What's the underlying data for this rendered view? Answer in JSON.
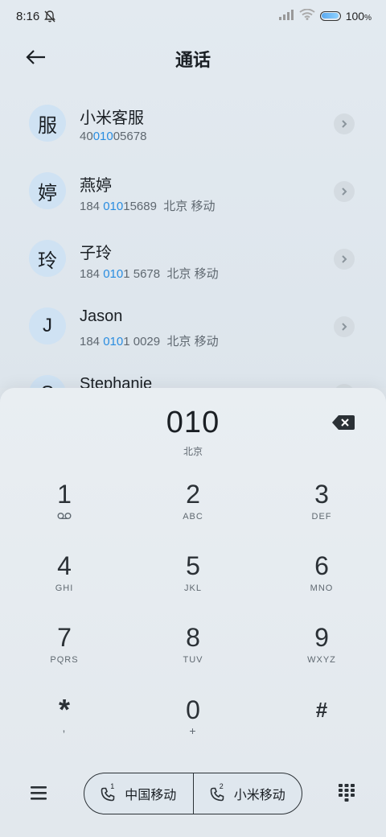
{
  "status": {
    "time": "8:16",
    "battery": "100",
    "battery_unit": "%"
  },
  "header": {
    "title": "通话"
  },
  "contacts": [
    {
      "avatar": "服",
      "name": "小米客服",
      "pre": "40",
      "hl": "010",
      "post": "05678",
      "loc": ""
    },
    {
      "avatar": "婷",
      "name": "燕婷",
      "pre": "184 ",
      "hl": "010",
      "post": "15689",
      "loc": "  北京 移动"
    },
    {
      "avatar": "玲",
      "name": "子玲",
      "pre": "184 ",
      "hl": "010",
      "post": "1 5678",
      "loc": "  北京 移动"
    },
    {
      "avatar": "J",
      "name": "Jason",
      "pre": "184 ",
      "hl": "010",
      "post": "1 0029",
      "loc": "  北京 移动"
    },
    {
      "avatar": "S",
      "name": "Stephanie",
      "pre": "",
      "hl": "",
      "post": "",
      "loc": ""
    }
  ],
  "dialer": {
    "number": "010",
    "location": "北京",
    "keys": [
      {
        "d": "1",
        "l": ""
      },
      {
        "d": "2",
        "l": "ABC"
      },
      {
        "d": "3",
        "l": "DEF"
      },
      {
        "d": "4",
        "l": "GHI"
      },
      {
        "d": "5",
        "l": "JKL"
      },
      {
        "d": "6",
        "l": "MNO"
      },
      {
        "d": "7",
        "l": "PQRS"
      },
      {
        "d": "8",
        "l": "TUV"
      },
      {
        "d": "9",
        "l": "WXYZ"
      },
      {
        "d": "*",
        "l": ","
      },
      {
        "d": "0",
        "l": "+"
      },
      {
        "d": "#",
        "l": ""
      }
    ]
  },
  "sim": {
    "sim1_index": "1",
    "sim1_label": "中国移动",
    "sim2_index": "2",
    "sim2_label": "小米移动"
  },
  "icons": {
    "voicemail": "voicemail-icon",
    "backspace": "backspace-icon",
    "menu": "menu-icon",
    "dialpad": "dialpad-icon"
  }
}
